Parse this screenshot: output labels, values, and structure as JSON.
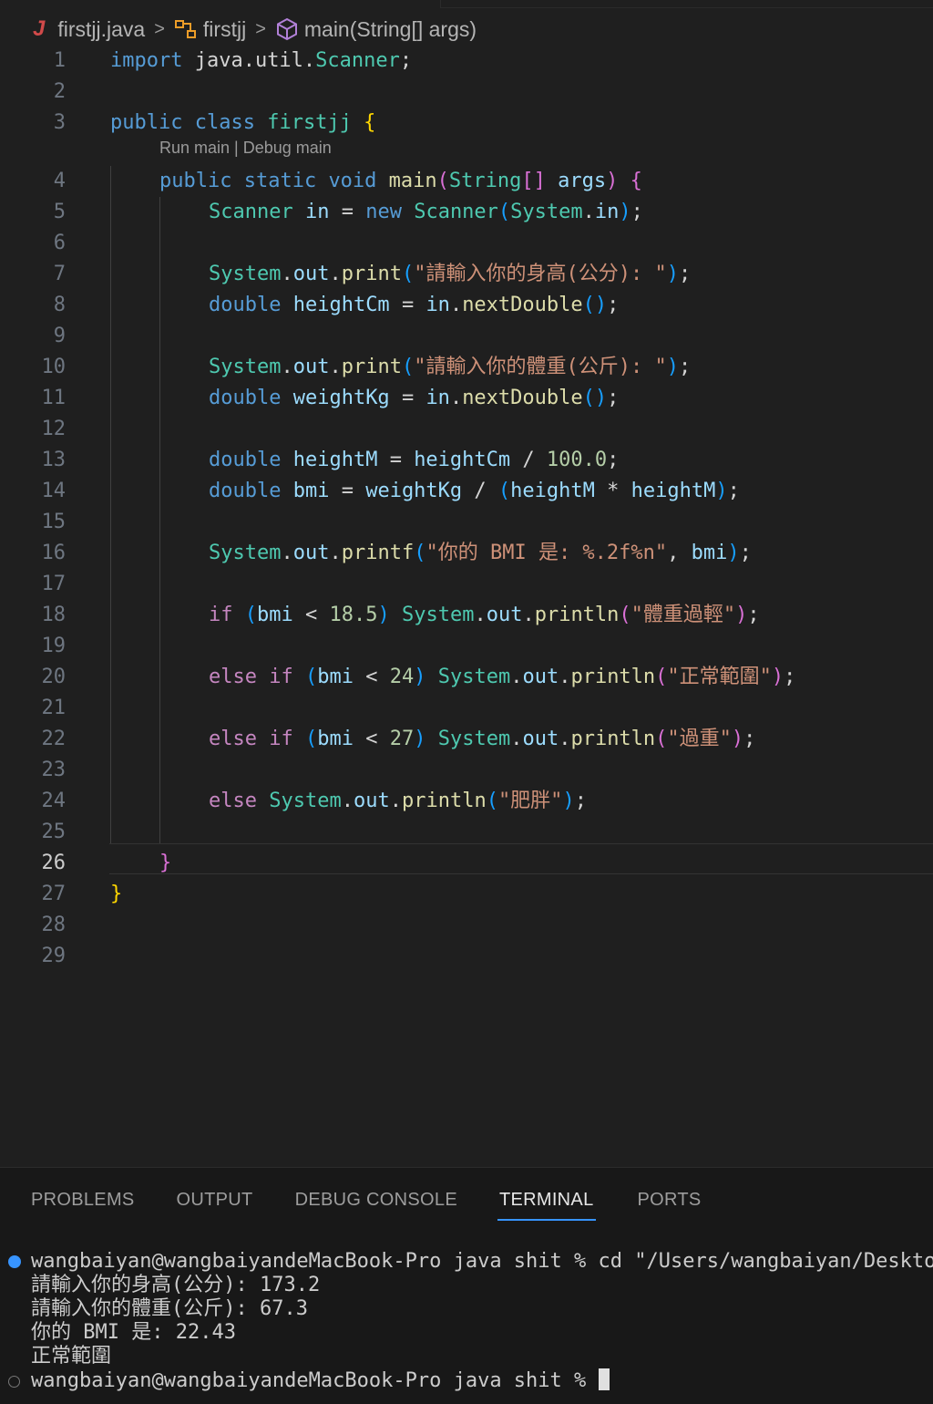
{
  "breadcrumb": {
    "file_icon": "J",
    "file": "firstjj.java",
    "class": "firstjj",
    "method": "main(String[] args)"
  },
  "codelens": "Run main | Debug main",
  "line_numbers": [
    "1",
    "2",
    "3",
    "4",
    "5",
    "6",
    "7",
    "8",
    "9",
    "10",
    "11",
    "12",
    "13",
    "14",
    "15",
    "16",
    "17",
    "18",
    "19",
    "20",
    "21",
    "22",
    "23",
    "24",
    "25",
    "26",
    "27",
    "28",
    "29"
  ],
  "active_line": "26",
  "code": {
    "l1": [
      "import",
      "java.util.",
      "Scanner",
      ";"
    ],
    "l3": [
      "public",
      "class",
      "firstjj",
      "{"
    ],
    "l4": [
      "public",
      "static",
      "void",
      "main",
      "(",
      "String",
      "[]",
      "args",
      ")",
      "{"
    ],
    "l5": [
      "Scanner",
      "in",
      "=",
      "new",
      "Scanner",
      "(",
      "System",
      ".",
      "in",
      ")",
      ";"
    ],
    "l7": [
      "System",
      ".",
      "out",
      ".",
      "print",
      "(",
      "\"請輸入你的身高(公分): \"",
      ")",
      ";"
    ],
    "l8": [
      "double",
      "heightCm",
      "=",
      "in",
      ".",
      "nextDouble",
      "()",
      ";"
    ],
    "l10": [
      "System",
      ".",
      "out",
      ".",
      "print",
      "(",
      "\"請輸入你的體重(公斤): \"",
      ")",
      ";"
    ],
    "l11": [
      "double",
      "weightKg",
      "=",
      "in",
      ".",
      "nextDouble",
      "()",
      ";"
    ],
    "l13": [
      "double",
      "heightM",
      "=",
      "heightCm",
      "/",
      "100.0",
      ";"
    ],
    "l14": [
      "double",
      "bmi",
      "=",
      "weightKg",
      "/",
      "(",
      "heightM",
      "*",
      "heightM",
      ")",
      ";"
    ],
    "l16": [
      "System",
      ".",
      "out",
      ".",
      "printf",
      "(",
      "\"你的 BMI 是: %.2f%n\"",
      ", ",
      "bmi",
      ")",
      ";"
    ],
    "l18": [
      "if",
      "(",
      "bmi",
      "<",
      "18.5",
      ")",
      "System",
      ".",
      "out",
      ".",
      "println",
      "(",
      "\"體重過輕\"",
      ")",
      ";"
    ],
    "l20": [
      "else",
      "if",
      "(",
      "bmi",
      "<",
      "24",
      ")",
      "System",
      ".",
      "out",
      ".",
      "println",
      "(",
      "\"正常範圍\"",
      ")",
      ";"
    ],
    "l22": [
      "else",
      "if",
      "(",
      "bmi",
      "<",
      "27",
      ")",
      "System",
      ".",
      "out",
      ".",
      "println",
      "(",
      "\"過重\"",
      ")",
      ";"
    ],
    "l24": [
      "else",
      "System",
      ".",
      "out",
      ".",
      "println",
      "(",
      "\"肥胖\"",
      ")",
      ";"
    ],
    "l26": [
      "}"
    ],
    "l27": [
      "}"
    ]
  },
  "panel": {
    "tabs": [
      "PROBLEMS",
      "OUTPUT",
      "DEBUG CONSOLE",
      "TERMINAL",
      "PORTS"
    ],
    "active_tab": "TERMINAL"
  },
  "terminal": {
    "lines": [
      "wangbaiyan@wangbaiyandeMacBook-Pro java shit % cd \"/Users/wangbaiyan/Desktop",
      "請輸入你的身高(公分): 173.2",
      "請輸入你的體重(公斤): 67.3",
      "你的 BMI 是: 22.43",
      "正常範圍",
      "wangbaiyan@wangbaiyandeMacBook-Pro java shit % "
    ],
    "first_dot_color": "#3794ff",
    "last_dot_color": "#777777"
  }
}
